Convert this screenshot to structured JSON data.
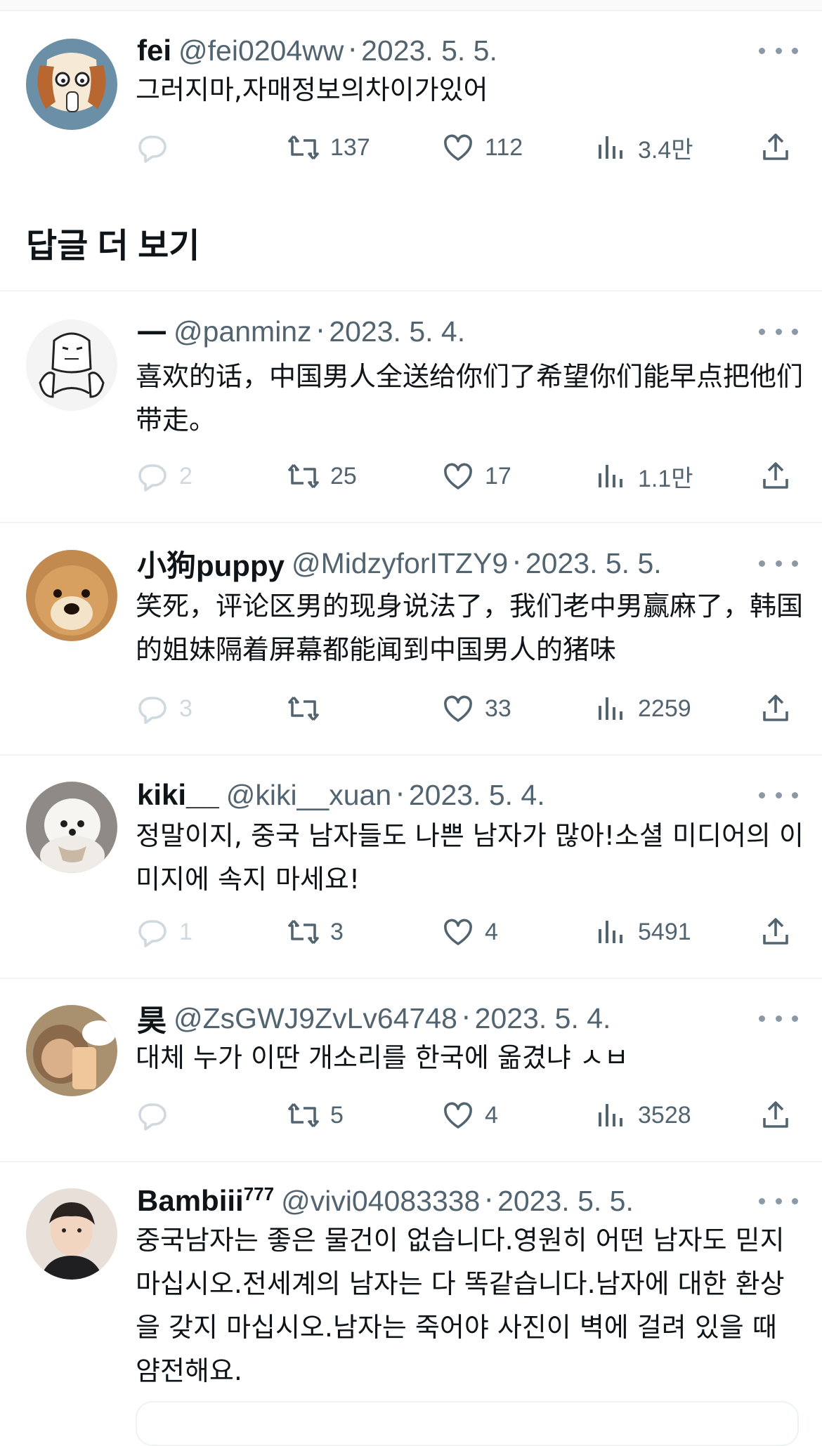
{
  "section_title": "답글 더 보기",
  "tweets": [
    {
      "name": "fei",
      "handle": "@fei0204ww",
      "date": "2023. 5. 5.",
      "text": "그러지마,자매정보의차이가있어",
      "replies": "",
      "retweets": "137",
      "likes": "112",
      "views": "3.4만"
    },
    {
      "name": "一",
      "handle": "@panminz",
      "date": "2023. 5. 4.",
      "text": "喜欢的话，中国男人全送给你们了希望你们能早点把他们带走。",
      "replies": "2",
      "retweets": "25",
      "likes": "17",
      "views": "1.1만"
    },
    {
      "name": "小狗puppy",
      "handle": "@MidzyforITZY9",
      "date": "2023. 5. 5.",
      "text": "笑死，评论区男的现身说法了，我们老中男赢麻了，韩国的姐妹隔着屏幕都能闻到中国男人的猪味",
      "replies": "3",
      "retweets": "",
      "likes": "33",
      "views": "2259"
    },
    {
      "name": "kiki__",
      "handle": "@kiki__xuan",
      "date": "2023. 5. 4.",
      "text": "정말이지, 중국 남자들도 나쁜 남자가 많아!소셜 미디어의 이미지에 속지 마세요!",
      "replies": "1",
      "retweets": "3",
      "likes": "4",
      "views": "5491"
    },
    {
      "name": "昊",
      "handle": "@ZsGWJ9ZvLv64748",
      "date": "2023. 5. 4.",
      "text": "대체 누가 이딴 개소리를 한국에 옮겼냐 ㅅㅂ",
      "replies": "",
      "retweets": "5",
      "likes": "4",
      "views": "3528"
    },
    {
      "name": "Bambiii",
      "name_sup": "777",
      "handle": "@vivi04083338",
      "date": "2023. 5. 5.",
      "text": "중국남자는 좋은 물건이 없습니다.영원히 어떤 남자도 믿지 마십시오.전세계의 남자는 다 똑같습니다.남자에 대한 환상을 갖지 마십시오.남자는 죽어야 사진이 벽에 걸려 있을 때 얌전해요."
    }
  ],
  "icons": {
    "reply": "reply-icon",
    "retweet": "retweet-icon",
    "like": "heart-icon",
    "views": "views-icon",
    "share": "share-icon",
    "more": "more-icon"
  },
  "colors": {
    "text": "#0f1419",
    "secondary": "#536471",
    "border": "#eff3f4"
  }
}
